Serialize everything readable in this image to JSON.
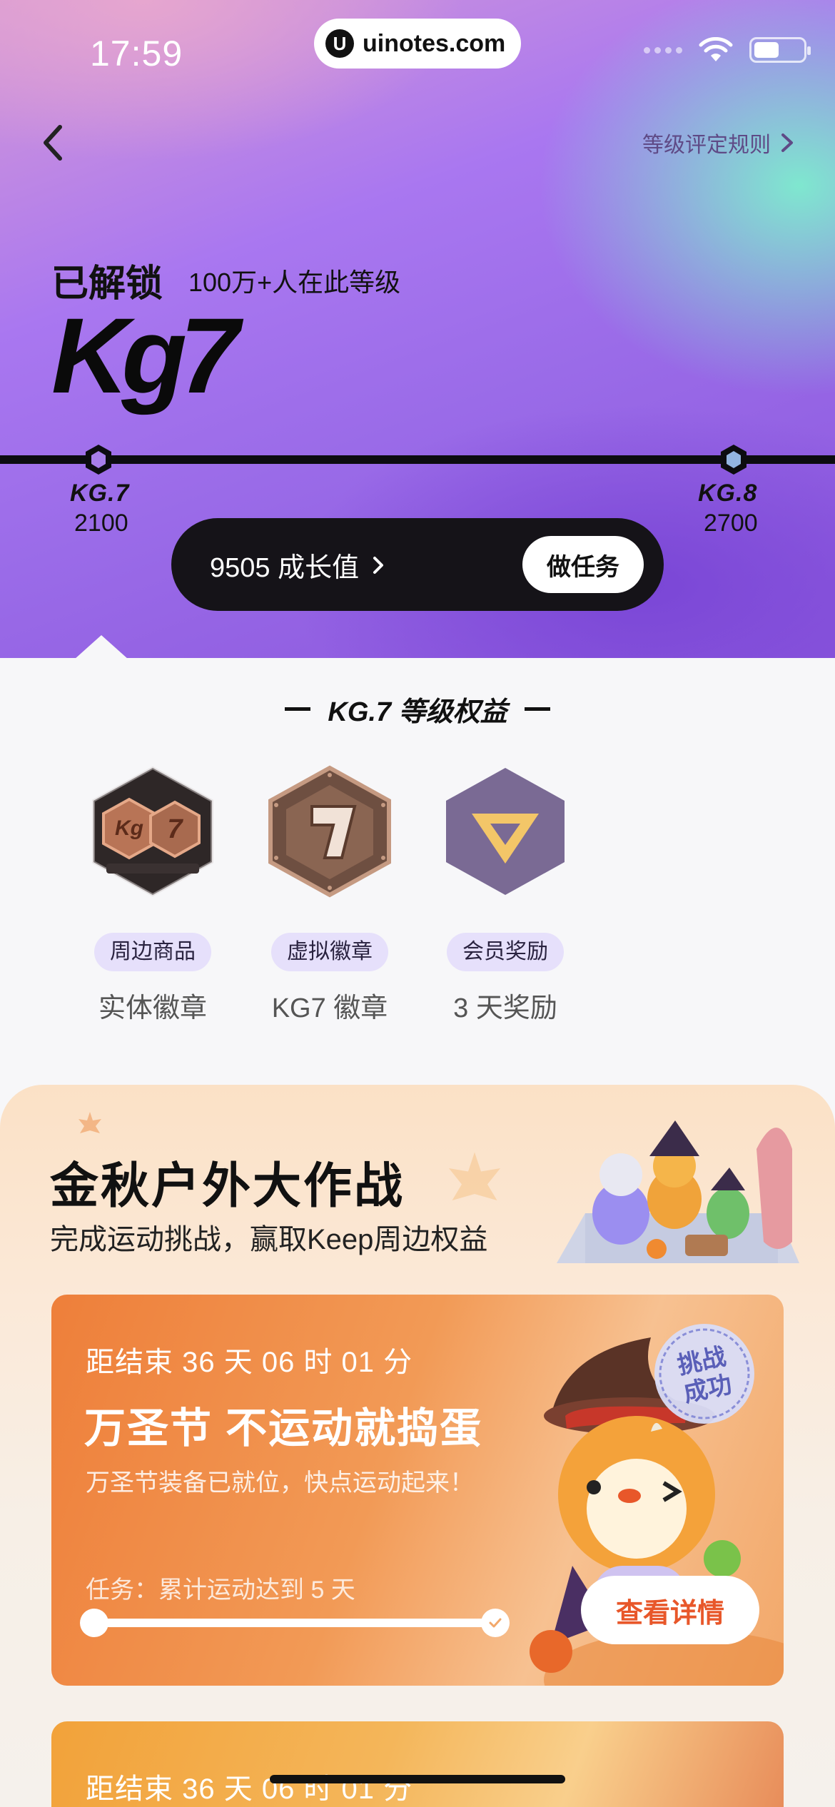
{
  "status_bar": {
    "time": "17:59"
  },
  "watermark": {
    "text": "uinotes.com",
    "logo": "U"
  },
  "header": {
    "rules_label": "等级评定规则"
  },
  "level": {
    "unlocked_label": "已解锁",
    "people_text": "100万+人在此等级",
    "logo_text": "Kg7",
    "current": {
      "label": "KG.7",
      "value": "2100"
    },
    "next": {
      "label": "KG.8",
      "value": "2700"
    },
    "progress_fraction": 0.0
  },
  "growth": {
    "label": "9505 成长值",
    "task_button": "做任务"
  },
  "benefits": {
    "title": "KG.7 等级权益",
    "items": [
      {
        "tag": "周边商品",
        "name": "实体徽章",
        "icon": "physical-badge"
      },
      {
        "tag": "虚拟徽章",
        "name": "KG7 徽章",
        "icon": "virtual-badge"
      },
      {
        "tag": "会员奖励",
        "name": "3 天奖励",
        "icon": "vip-reward"
      }
    ]
  },
  "campaign": {
    "title": "金秋户外大作战",
    "subtitle": "完成运动挑战，赢取Keep周边权益",
    "cards": [
      {
        "countdown": "距结束 36 天 06 时 01 分",
        "title": "万圣节 不运动就捣蛋",
        "desc": "万圣节装备已就位，快点运动起来！",
        "task": "任务：累计运动达到 5 天",
        "progress": 1.0,
        "stamp": "挑战成功",
        "button": "查看详情"
      },
      {
        "countdown": "距结束 36 天 06 时 01 分"
      }
    ]
  },
  "colors": {
    "accent_orange": "#e8572a",
    "tag_bg": "#e6e0fb",
    "pill_dark": "#151318"
  }
}
